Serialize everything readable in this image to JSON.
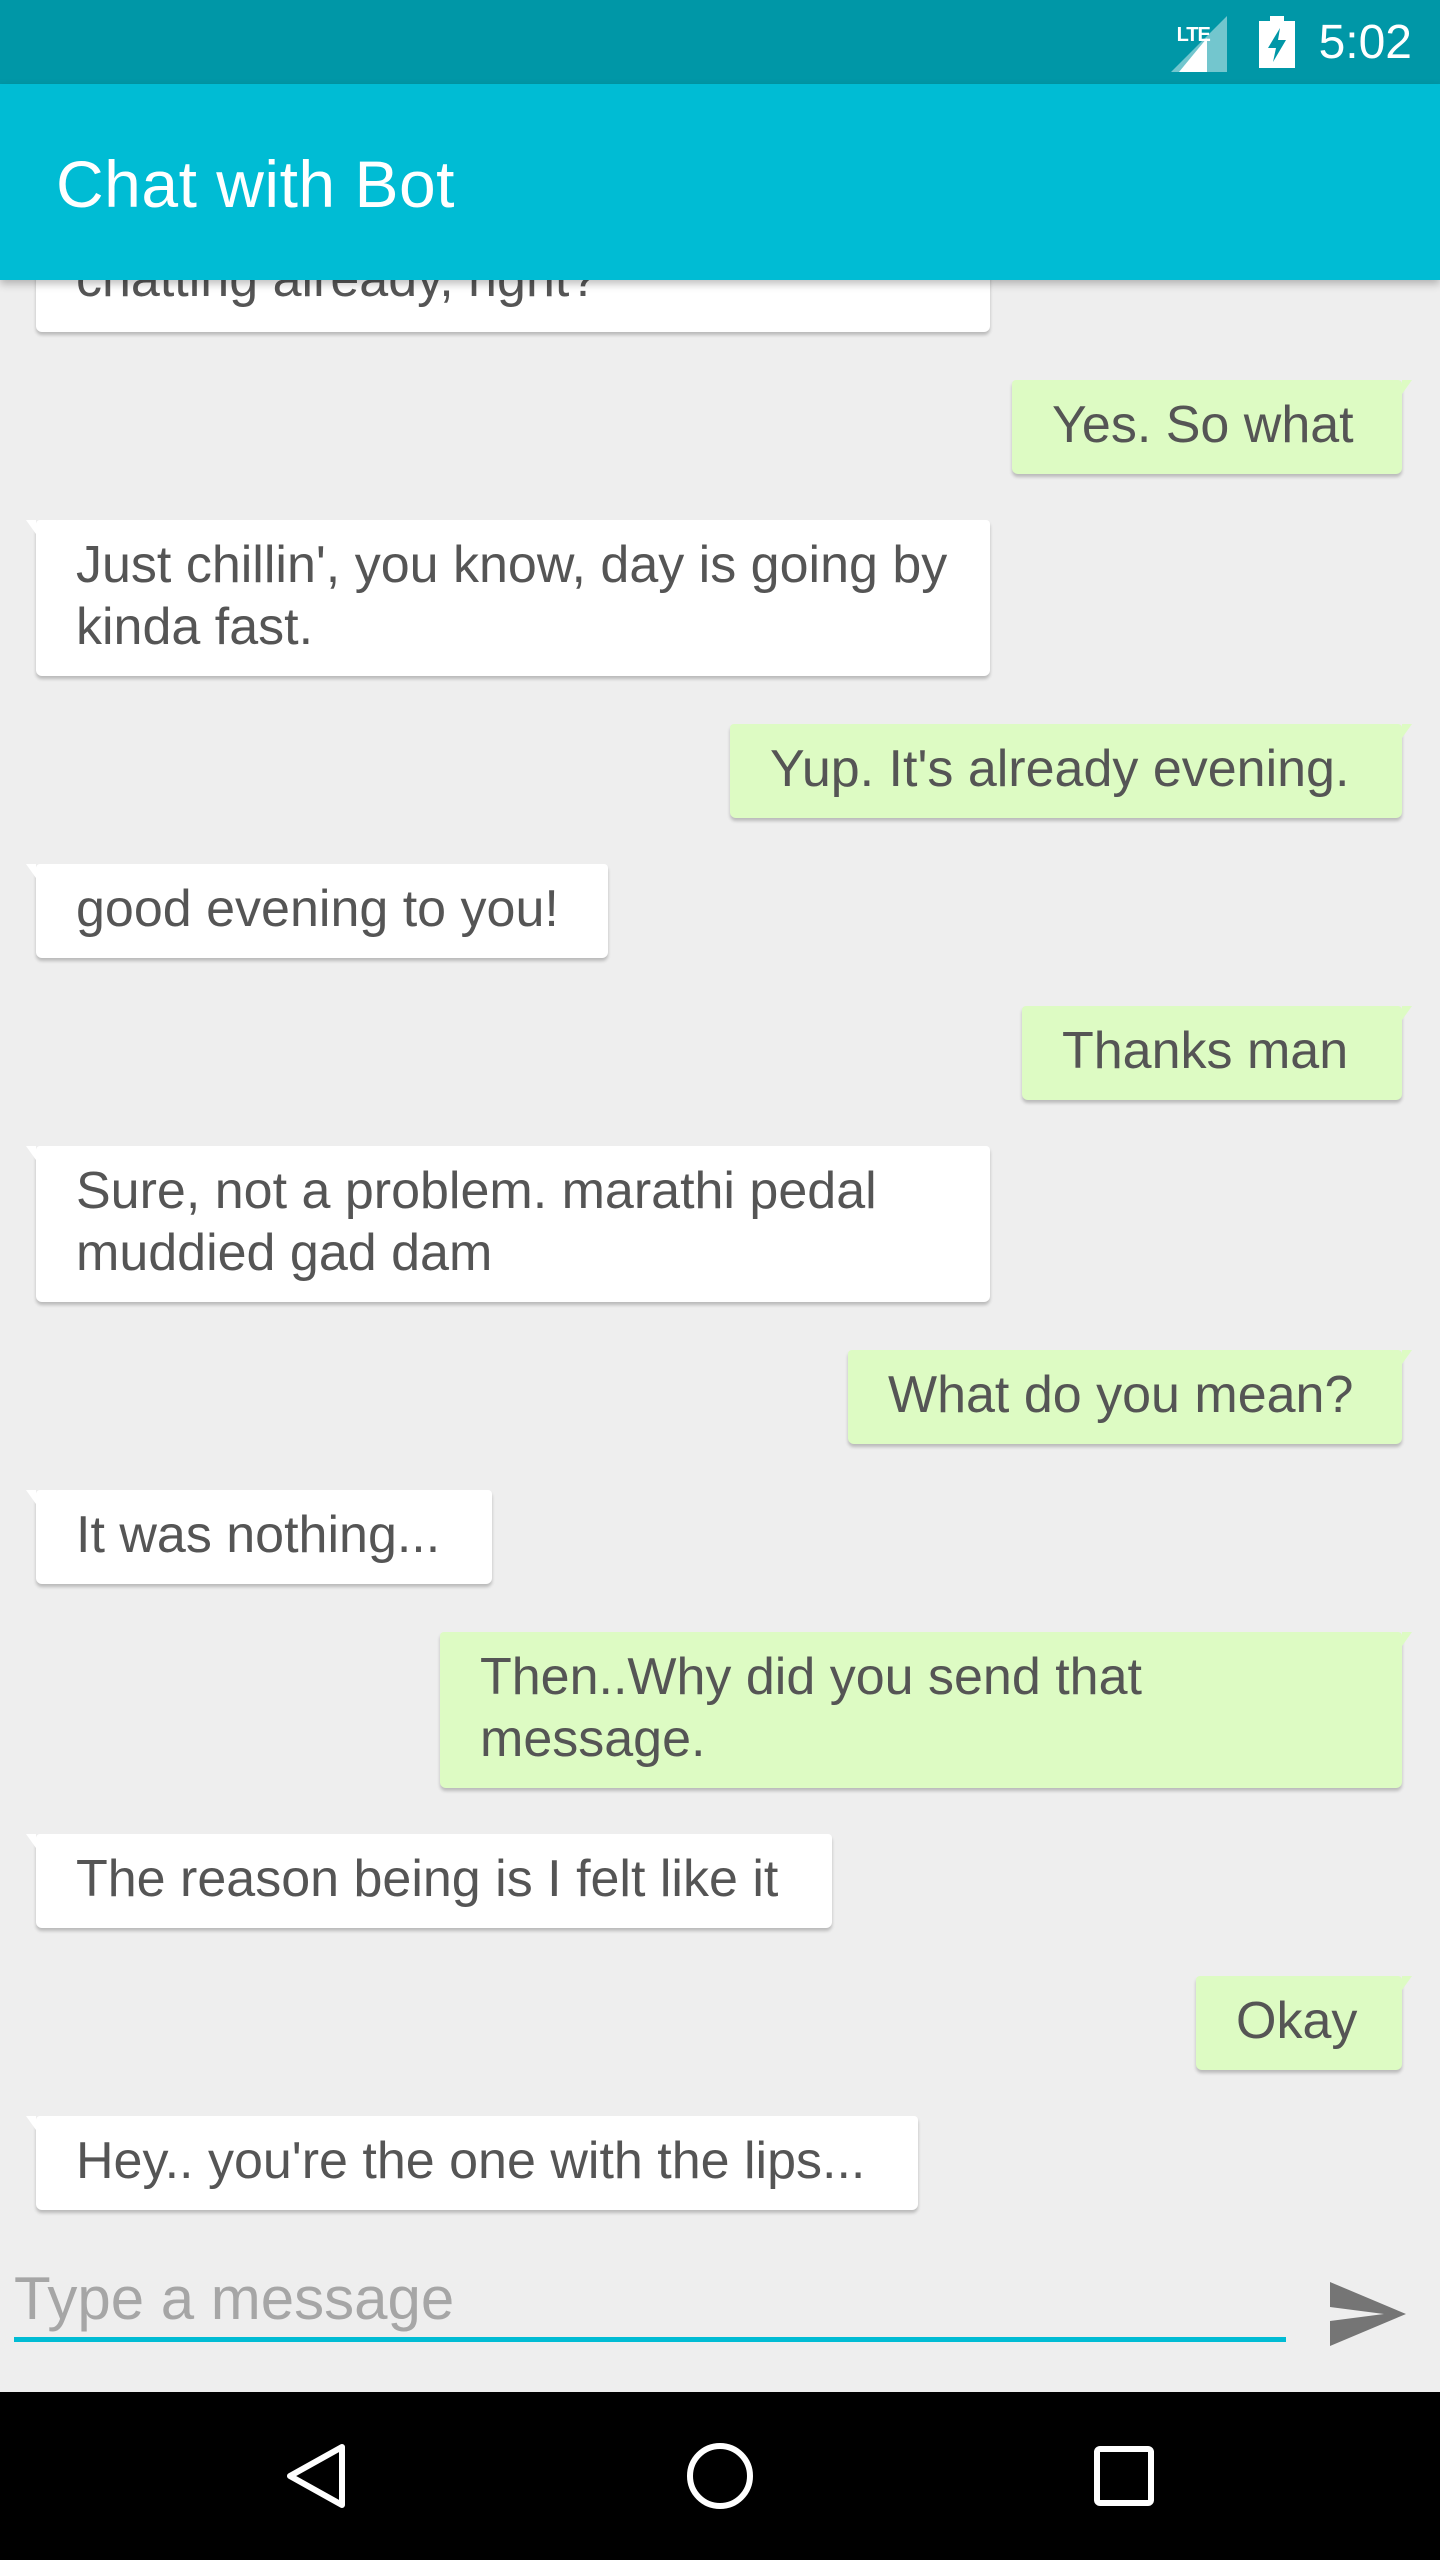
{
  "status_bar": {
    "network": "LTE",
    "time": "5:02"
  },
  "app_bar": {
    "title": "Chat with Bot"
  },
  "messages": [
    {
      "sender": "bot",
      "text": "chatting already, right?"
    },
    {
      "sender": "user",
      "text": "Yes. So what"
    },
    {
      "sender": "bot",
      "text": "Just chillin', you know, day is going by kinda fast."
    },
    {
      "sender": "user",
      "text": "Yup. It's already evening."
    },
    {
      "sender": "bot",
      "text": "good evening to you!"
    },
    {
      "sender": "user",
      "text": "Thanks man"
    },
    {
      "sender": "bot",
      "text": "Sure, not a problem. marathi pedal muddied gad dam"
    },
    {
      "sender": "user",
      "text": "What do you mean?"
    },
    {
      "sender": "bot",
      "text": "It was nothing..."
    },
    {
      "sender": "user",
      "text": "Then..Why did you send that message."
    },
    {
      "sender": "bot",
      "text": "The reason being is I felt like it"
    },
    {
      "sender": "user",
      "text": "Okay"
    },
    {
      "sender": "bot",
      "text": "Hey.. you're the one with the lips..."
    }
  ],
  "composer": {
    "placeholder": "Type a message",
    "value": "",
    "send_icon": "send-icon"
  },
  "nav": {
    "back_icon": "back-icon",
    "home_icon": "home-icon",
    "recents_icon": "recents-icon"
  },
  "colors": {
    "status_bar": "#0097a7",
    "app_bar": "#00bcd4",
    "bot_bubble": "#ffffff",
    "user_bubble": "#ddfbc3",
    "background": "#eeeeee"
  }
}
